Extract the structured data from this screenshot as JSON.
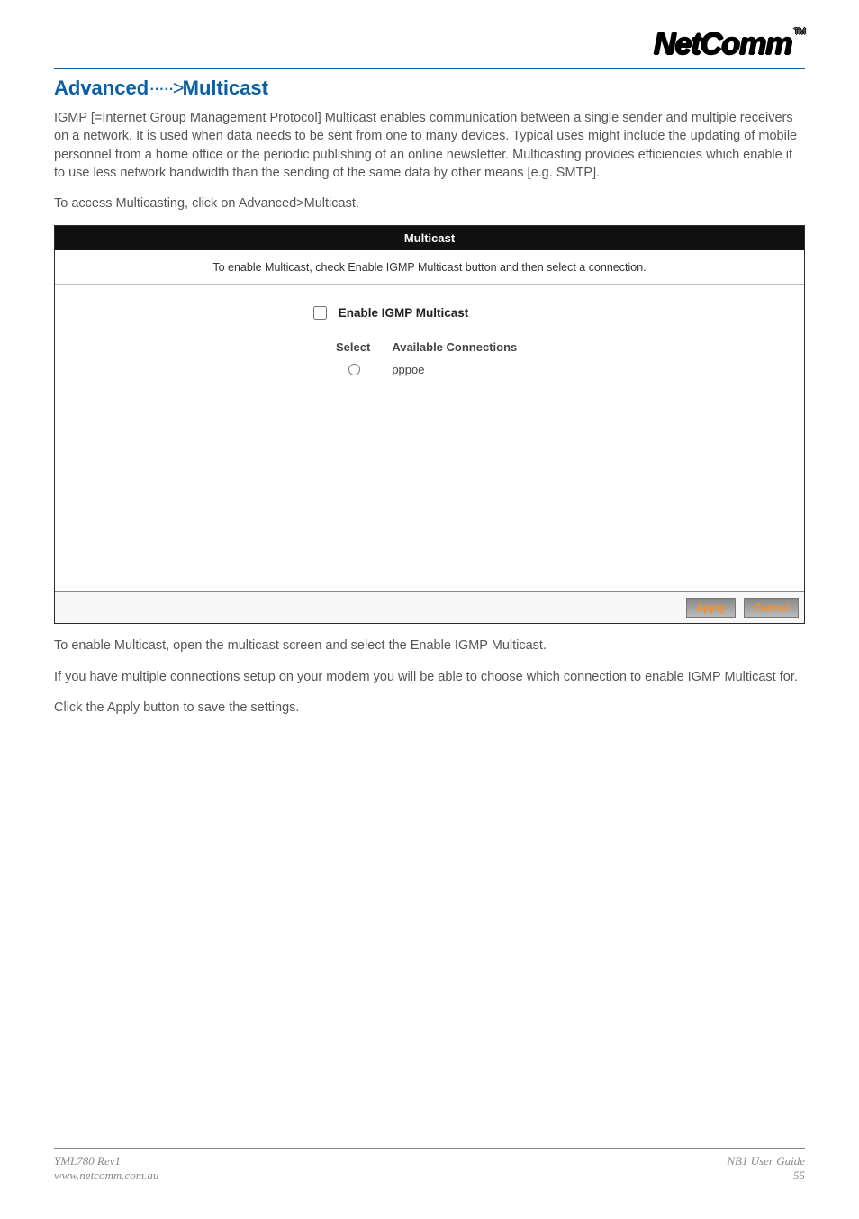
{
  "brand": {
    "logo": "NetComm",
    "tm": "TM"
  },
  "section_title_a": "Advanced",
  "section_title_sep": "·····>",
  "section_title_b": "Multicast",
  "paragraphs": {
    "p1": "IGMP [=Internet Group Management Protocol] Multicast enables communication between a single sender and multiple receivers on a network. It is used when data needs to be sent from one to many devices. Typical uses might include the updating of mobile personnel from a home office or the periodic publishing of an online newsletter. Multicasting provides efficiencies which enable it to use less network bandwidth than the sending of the same data by other means [e.g. SMTP].",
    "p2": "To access Multicasting, click on Advanced>Multicast.",
    "p3": "To enable Multicast, open the multicast screen and select the Enable IGMP Multicast.",
    "p4": "If you have multiple connections setup on your modem you will be able to choose which connection to enable IGMP Multicast for.",
    "p5": "Click the Apply button to save the settings."
  },
  "multicast": {
    "header": "Multicast",
    "instruction": "To enable Multicast, check Enable IGMP Multicast button and then select a connection.",
    "enable_label": "Enable IGMP Multicast",
    "columns": {
      "select": "Select",
      "conn": "Available Connections"
    },
    "rows": [
      {
        "name": "pppoe"
      }
    ],
    "buttons": {
      "apply": "Apply",
      "cancel": "Cancel"
    }
  },
  "footer": {
    "left1": "YML780 Rev1",
    "left2": "www.netcomm.com.au",
    "right1": "NB1 User Guide",
    "right2": "55"
  }
}
